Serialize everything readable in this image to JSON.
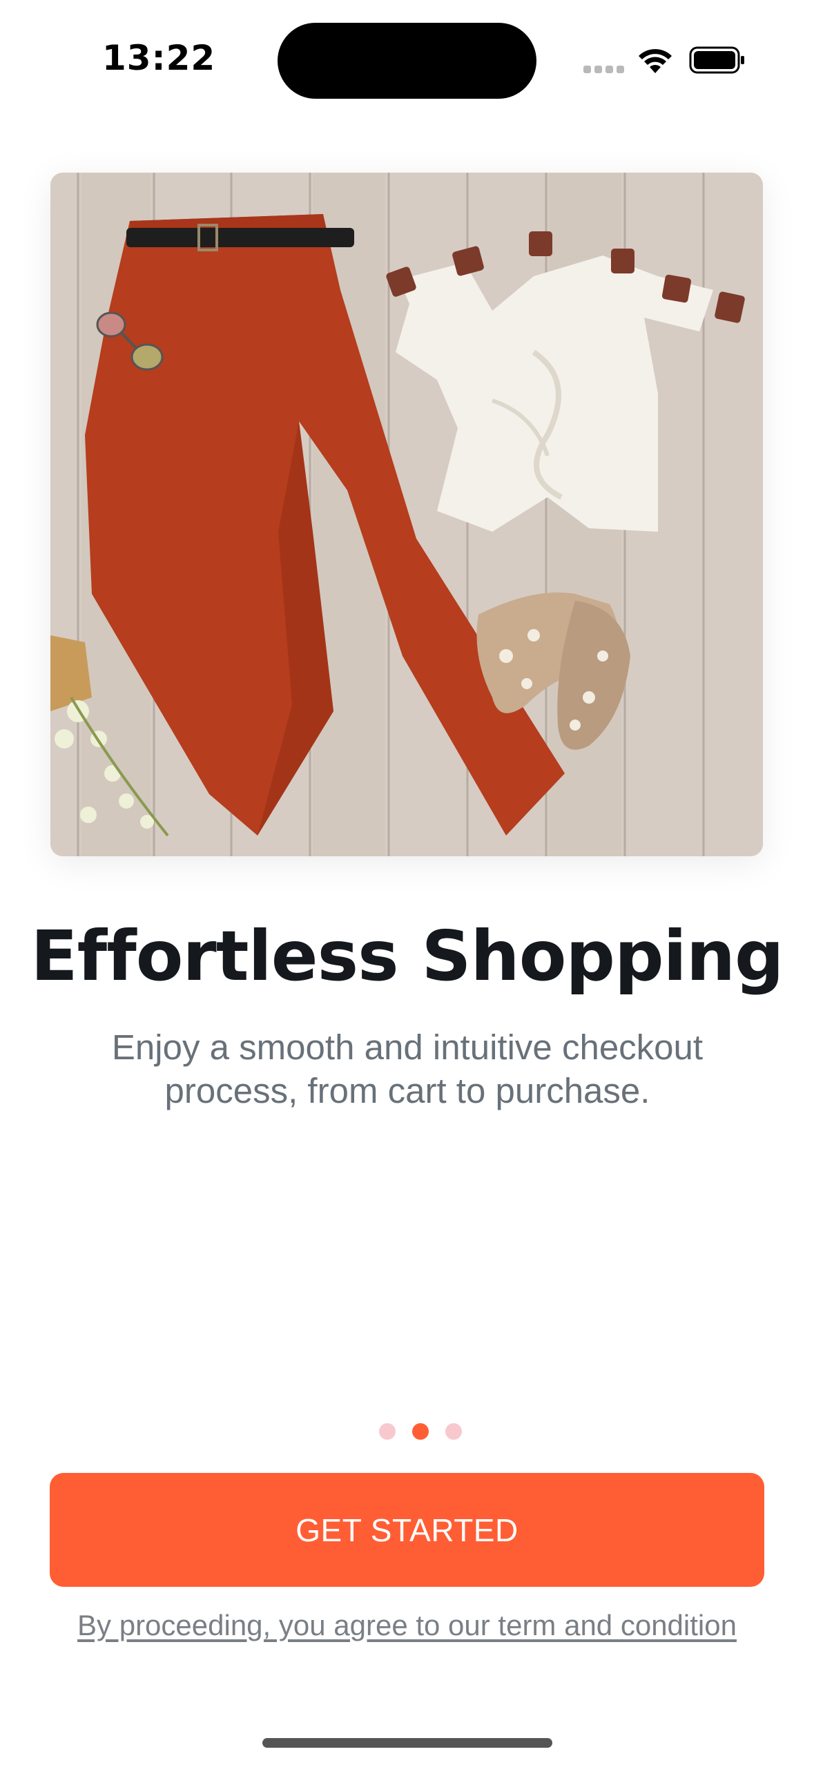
{
  "status_bar": {
    "time": "13:22"
  },
  "hero": {
    "image": "flat-lay-outfit-photo"
  },
  "onboarding": {
    "title": "Effortless Shopping",
    "subtitle": "Enjoy a smooth and intuitive checkout process, from cart to purchase.",
    "pager": {
      "total": 3,
      "active_index": 1
    }
  },
  "actions": {
    "primary_label": "GET STARTED",
    "terms_text": "By proceeding, you agree to our term and condition"
  },
  "colors": {
    "accent": "#ff5e35",
    "accent_light": "#f7c9cf",
    "title": "#15191e",
    "subtitle": "#687179"
  }
}
